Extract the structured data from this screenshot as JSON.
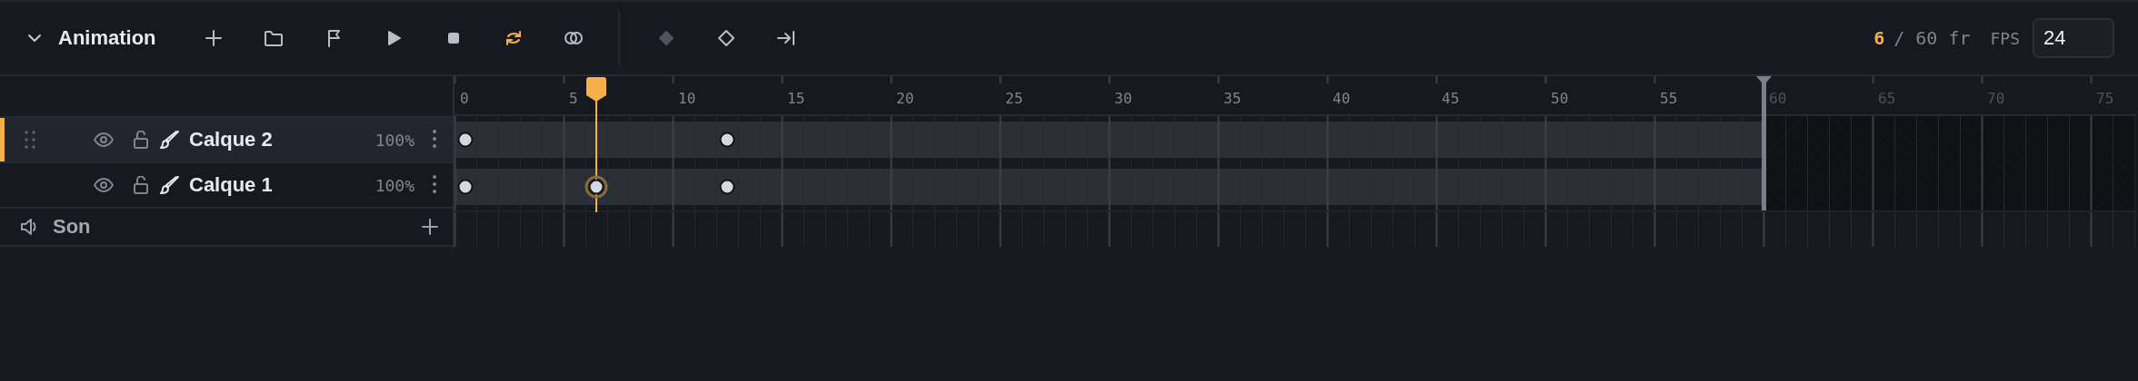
{
  "panel": {
    "title": "Animation",
    "expanded": true
  },
  "toolbar": [
    {
      "kind": "add"
    },
    {
      "kind": "folder"
    },
    {
      "kind": "flag"
    },
    {
      "kind": "play"
    },
    {
      "kind": "stop"
    },
    {
      "kind": "loop",
      "on": true
    },
    {
      "kind": "onion",
      "on": false
    },
    {
      "kind": "separator"
    },
    {
      "kind": "keyframe-filled",
      "disabled": true
    },
    {
      "kind": "keyframe",
      "disabled": false
    },
    {
      "kind": "jump-end",
      "disabled": false
    }
  ],
  "frame_counter": {
    "current": "6",
    "total": "/ 60 fr"
  },
  "fps": {
    "label": "FPS",
    "value": "24"
  },
  "timeline": {
    "ruler": [
      "0",
      "5",
      "10",
      "15",
      "20",
      "25",
      "30",
      "35",
      "40",
      "45",
      "50",
      "55",
      "60",
      "65",
      "70",
      "75"
    ],
    "playhead": {
      "level": 0.0843
    },
    "end_marker": {
      "level": 0.7784
    }
  },
  "layers": [
    {
      "name": "Calque 2",
      "opacity": "100%",
      "selected": true,
      "visible": true,
      "locked": false,
      "keyframes": [
        {
          "level": 0.0083,
          "selected": false
        },
        {
          "level": 0.2083,
          "selected": false
        }
      ]
    },
    {
      "name": "Calque 1",
      "opacity": "100%",
      "selected": false,
      "visible": true,
      "locked": false,
      "keyframes": [
        {
          "level": 0.0083,
          "selected": false
        },
        {
          "level": 0.1083,
          "selected": true
        },
        {
          "level": 0.2083,
          "selected": false
        }
      ]
    }
  ],
  "sound": {
    "label": "Son"
  }
}
